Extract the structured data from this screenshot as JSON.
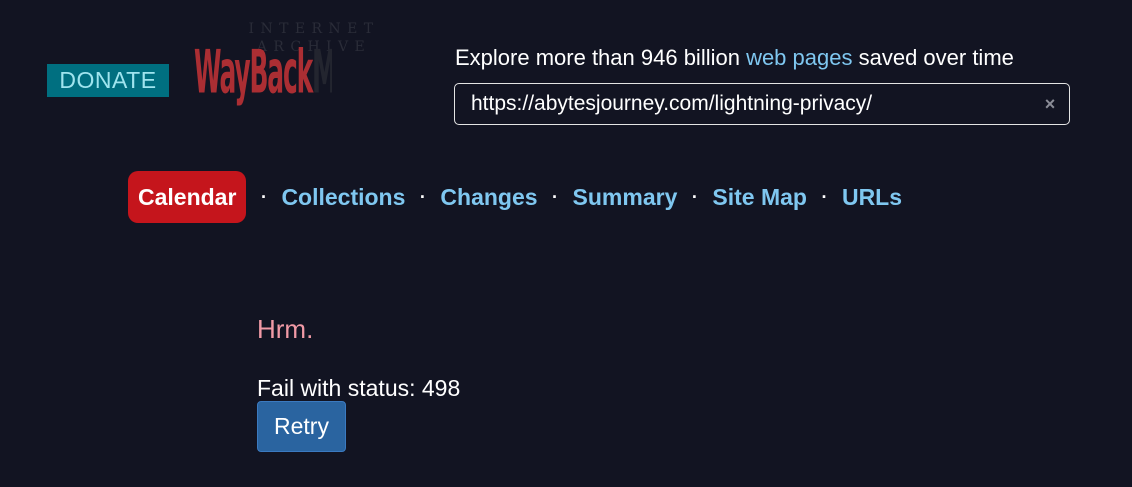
{
  "header": {
    "donate_label": "DONATE",
    "logo": {
      "internet_archive": "INTERNET ARCHIVE",
      "way": "Way",
      "back": "Back",
      "machine": "Machine"
    },
    "explore_prefix": "Explore more than 946 billion ",
    "explore_link": "web pages",
    "explore_suffix": " saved over time",
    "search": {
      "value": "https://abytesjourney.com/lightning-privacy/",
      "clear_icon": "×"
    }
  },
  "nav": {
    "tabs": [
      {
        "label": "Calendar",
        "active": true
      },
      {
        "label": "Collections"
      },
      {
        "label": "Changes"
      },
      {
        "label": "Summary"
      },
      {
        "label": "Site Map"
      },
      {
        "label": "URLs"
      }
    ],
    "separator": "·"
  },
  "error": {
    "title": "Hrm.",
    "status": "Fail with status: 498",
    "retry_label": "Retry"
  },
  "colors": {
    "background": "#121422",
    "active_tab": "#c5151c",
    "link": "#7fc7f0",
    "error_title": "#f19aa6",
    "retry_button": "#2a64a0",
    "donate": "#006f80",
    "logo_red": "#ab2e33"
  }
}
